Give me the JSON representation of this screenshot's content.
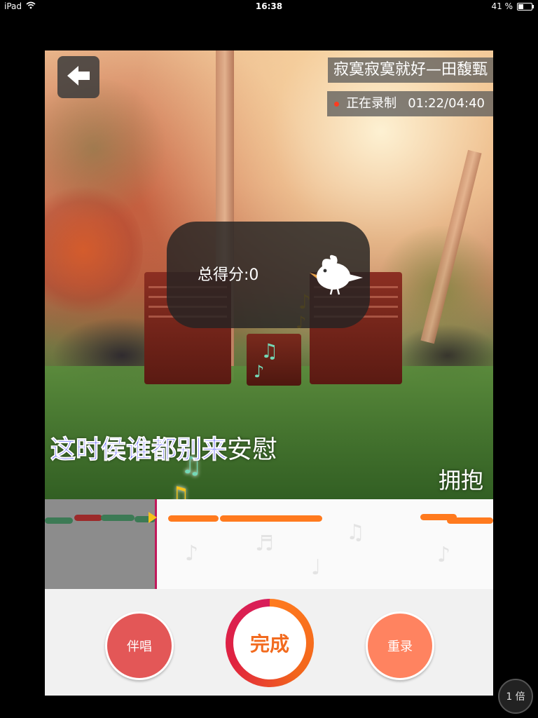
{
  "status_bar": {
    "device": "iPad",
    "time": "16:38",
    "battery": "41 %",
    "battery_level": 0.41
  },
  "header": {
    "song_title": "寂寞寂寞就好—田馥甄",
    "record_status": "正在录制",
    "record_time": "01:22/04:40"
  },
  "score": {
    "label": "总得分:0"
  },
  "lyrics": {
    "current_sung": "这时侯谁都别来",
    "current_unsung": "安慰",
    "next_line": "拥抱"
  },
  "controls": {
    "accompany_label": "伴唱",
    "done_label": "完成",
    "rerecord_label": "重录"
  },
  "zoom": {
    "label": "1 倍"
  },
  "colors": {
    "accent": "#f26b1f",
    "sung_lyric": "#3333ff",
    "recording_dot": "#ff3b1f",
    "accompany": "#e35757",
    "rerecord": "#ff8360"
  },
  "icons": {
    "back": "arrow-left-icon",
    "mascot": "bird-icon",
    "notes": "music-note-icon",
    "wifi": "wifi-icon",
    "battery": "battery-icon"
  }
}
